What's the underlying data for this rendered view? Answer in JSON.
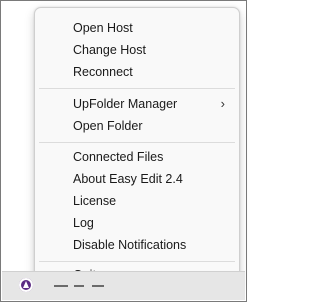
{
  "menu": {
    "items": [
      {
        "label": "Open Host"
      },
      {
        "label": "Change Host"
      },
      {
        "label": "Reconnect"
      },
      {
        "label": "UpFolder Manager",
        "submenu_icon": "chevron-right-icon",
        "chevron": "›"
      },
      {
        "label": "Open Folder"
      },
      {
        "label": "Connected Files"
      },
      {
        "label": "About Easy Edit 2.4"
      },
      {
        "label": "License"
      },
      {
        "label": "Log"
      },
      {
        "label": "Disable Notifications"
      },
      {
        "label": "Quit"
      }
    ]
  },
  "taskbar": {
    "tray_icon": "easy-edit-tray-icon"
  }
}
